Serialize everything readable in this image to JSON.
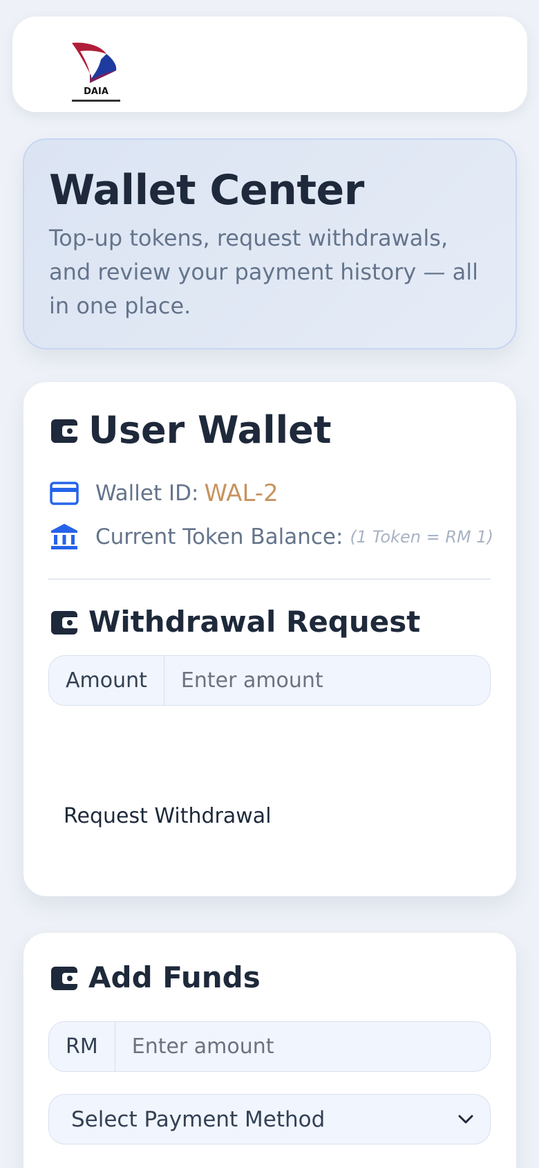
{
  "hero": {
    "title": "Wallet Center",
    "subtitle": "Top-up tokens, request withdrawals, and review your payment history — all in one place."
  },
  "wallet": {
    "title": "User Wallet",
    "wallet_id_label": "Wallet ID:",
    "wallet_id_value": "WAL-2",
    "balance_label": "Current Token Balance:",
    "rate_note": "(1 Token = RM 1)"
  },
  "withdrawal": {
    "title": "Withdrawal Request",
    "amount_addon": "Amount",
    "amount_placeholder": "Enter amount",
    "button_label": "Request Withdrawal"
  },
  "funds": {
    "title": "Add Funds",
    "currency_addon": "RM",
    "amount_placeholder": "Enter amount",
    "payment_method_selected": "Select Payment Method"
  },
  "colors": {
    "accent_blue": "#2563eb",
    "wallet_id": "#c8935f",
    "heading": "#1e293b",
    "muted": "#64748b"
  },
  "icons": {
    "logo": "daia-logo",
    "wallet": "wallet-icon",
    "card": "credit-card-icon",
    "bank": "bank-icon",
    "chevron": "chevron-down-icon"
  }
}
